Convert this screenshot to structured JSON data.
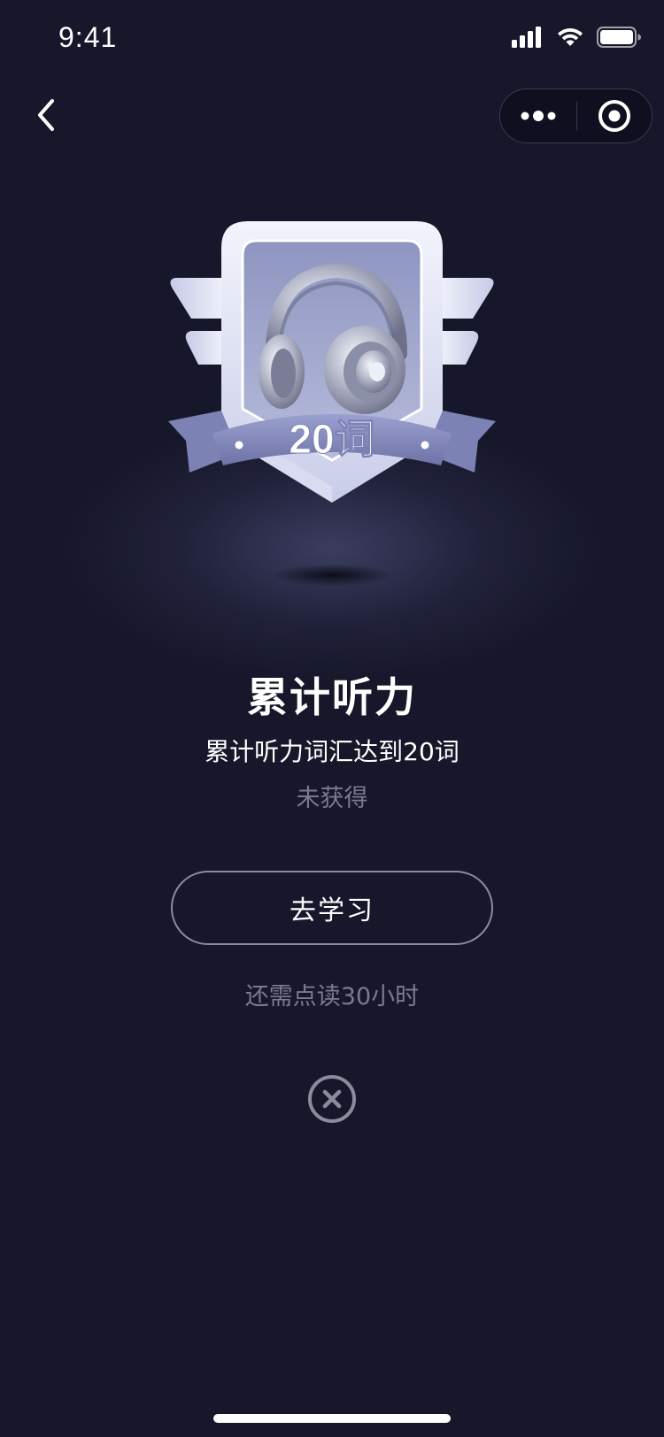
{
  "status_bar": {
    "time": "9:41",
    "icons": [
      "signal-icon",
      "wifi-icon",
      "battery-icon"
    ]
  },
  "nav": {
    "back_icon": "chevron-left-icon",
    "more_icon": "more-dots-icon",
    "close_icon": "target-icon"
  },
  "badge": {
    "label": "20词",
    "image": "headphones-icon",
    "colors": {
      "frame": "#e8ebf7",
      "inner": "#9aa0c8",
      "ribbon": "#8186b8",
      "wing": "#d6daf0"
    }
  },
  "content": {
    "title": "累计听力",
    "subtitle": "累计听力词汇达到20词",
    "state": "未获得",
    "button_label": "去学习",
    "hint": "还需点读30小时"
  },
  "close": {
    "icon": "close-circle-icon"
  },
  "colors": {
    "background": "#16172a",
    "muted_text": "#7a7b8e",
    "button_border": "#8a8b9c"
  }
}
